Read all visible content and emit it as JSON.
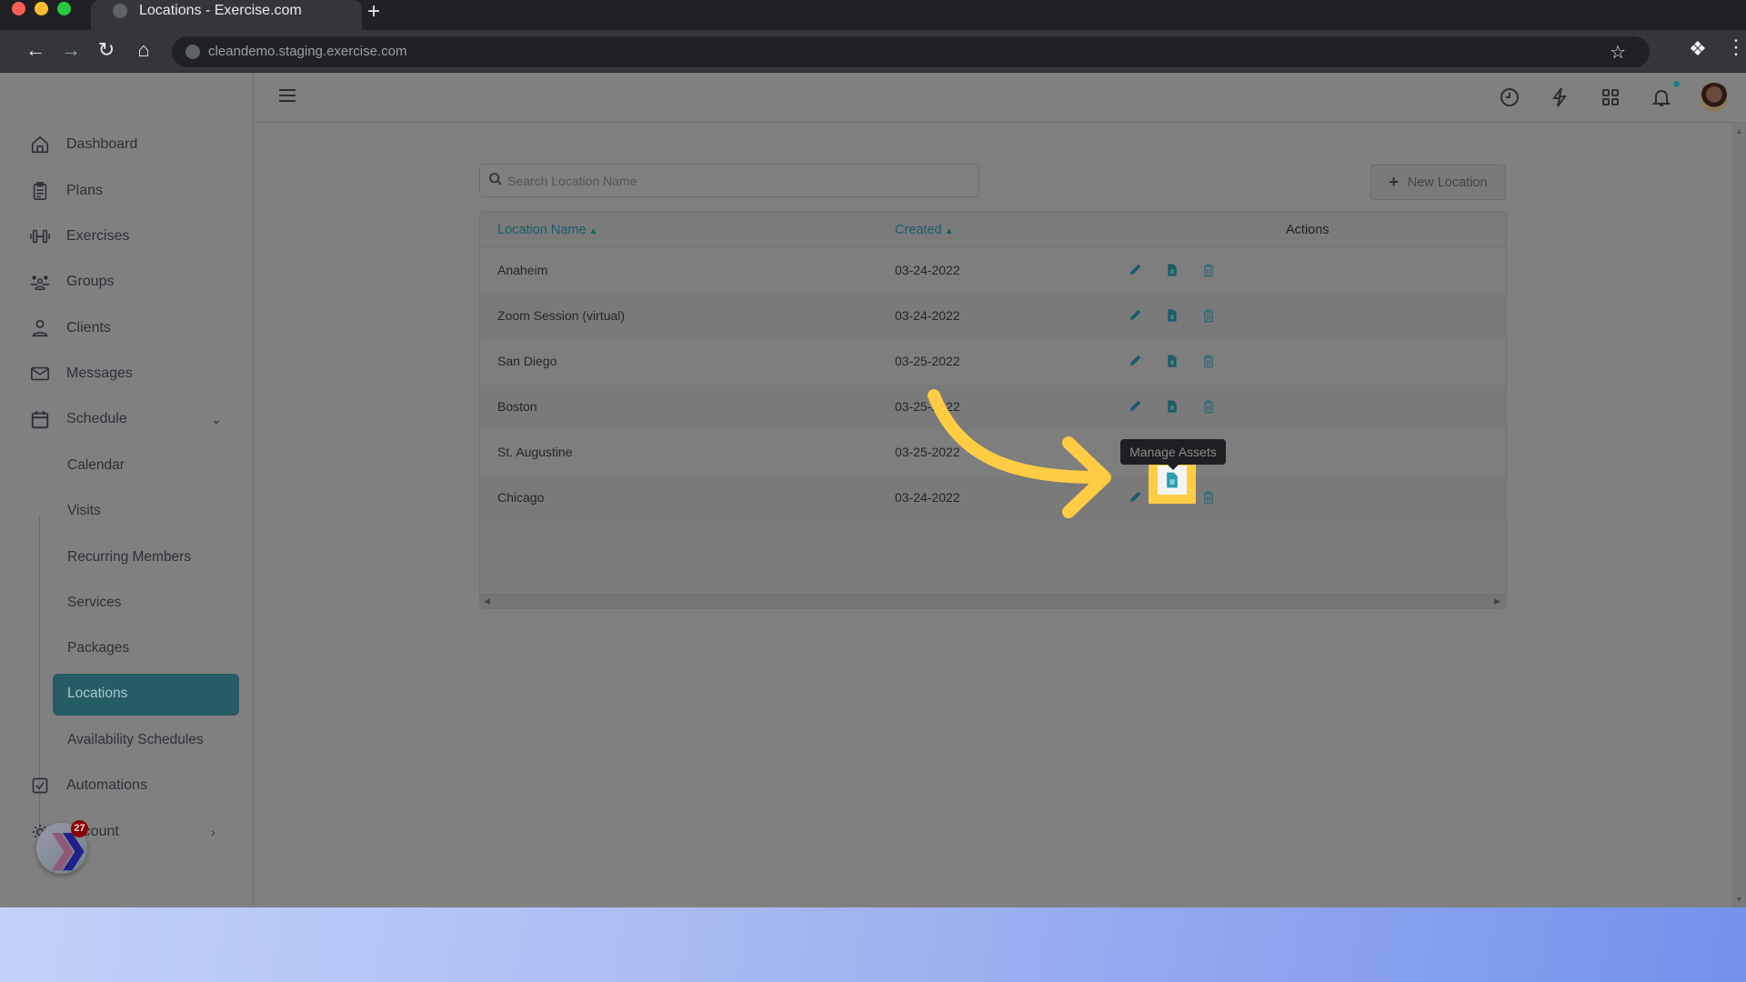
{
  "browser": {
    "tab_title": "Locations - Exercise.com",
    "url": "cleandemo.staging.exercise.com",
    "new_tab_label": "+",
    "traffic_colors": [
      "#ff5f57",
      "#febc2e",
      "#28c840"
    ]
  },
  "header": {
    "icons": [
      "history-icon",
      "lightning-icon",
      "apps-grid-icon",
      "bell-icon"
    ],
    "notification_dot_color": "#1e7e8c"
  },
  "sidebar": {
    "items": [
      {
        "label": "Dashboard",
        "icon": "home-icon"
      },
      {
        "label": "Plans",
        "icon": "clipboard-icon"
      },
      {
        "label": "Exercises",
        "icon": "dumbbell-icon"
      },
      {
        "label": "Groups",
        "icon": "group-icon"
      },
      {
        "label": "Clients",
        "icon": "user-icon"
      },
      {
        "label": "Messages",
        "icon": "envelope-icon"
      },
      {
        "label": "Schedule",
        "icon": "calendar-icon",
        "expanded": true
      }
    ],
    "schedule_sub": [
      {
        "label": "Calendar"
      },
      {
        "label": "Visits"
      },
      {
        "label": "Recurring Members"
      },
      {
        "label": "Services"
      },
      {
        "label": "Packages"
      },
      {
        "label": "Locations",
        "active": true
      },
      {
        "label": "Availability Schedules"
      }
    ],
    "bottom_items": [
      {
        "label": "Automations",
        "icon": "checkbox-icon"
      },
      {
        "label": "Account",
        "icon": "gear-icon"
      }
    ],
    "fab_badge_count": "27"
  },
  "main": {
    "search": {
      "placeholder": "Search Location Name",
      "value": ""
    },
    "new_button_label": "New Location",
    "table": {
      "columns": [
        {
          "label": "Location Name",
          "sortable": true
        },
        {
          "label": "Created",
          "sortable": true
        },
        {
          "label": "Actions",
          "sortable": false
        }
      ],
      "rows": [
        {
          "name": "Anaheim",
          "created": "03-24-2022"
        },
        {
          "name": "Zoom Session (virtual)",
          "created": "03-24-2022"
        },
        {
          "name": "San Diego",
          "created": "03-25-2022"
        },
        {
          "name": "Boston",
          "created": "03-25-2022"
        },
        {
          "name": "St. Augustine",
          "created": "03-25-2022"
        },
        {
          "name": "Chicago",
          "created": "03-24-2022"
        }
      ],
      "action_icons": [
        "edit-pencil-icon",
        "manage-assets-icon",
        "delete-trash-icon"
      ]
    },
    "tooltip": "Manage Assets",
    "highlighted_row": "Boston",
    "accent_color": "#1b5d68",
    "annotation_color": "#ffcc44"
  }
}
